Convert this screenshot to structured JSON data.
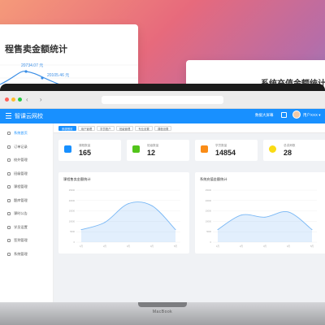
{
  "background": {
    "left_card_title": "课程售卖金额统计",
    "left_card_title_visible": "程售卖金额统计",
    "left_point_label_1": "20734.07 元",
    "left_point_label_2": "20105.46 元",
    "right_card_title": "系统充值金额统计"
  },
  "browser": {
    "dot_colors": [
      "#ff5f57",
      "#febc2e",
      "#28c840"
    ],
    "nav_arrows": "‹ ›"
  },
  "header": {
    "app_title": "智课云网校",
    "big_screen_label": "数据大屏幕",
    "user_name": "用户XXX ▾"
  },
  "sidebar": {
    "items": [
      {
        "label": "系统首页"
      },
      {
        "label": "订单记录"
      },
      {
        "label": "校外管理"
      },
      {
        "label": "班级管理"
      },
      {
        "label": "课程管理"
      },
      {
        "label": "题库管理"
      },
      {
        "label": "课时公告"
      },
      {
        "label": "学员设置"
      },
      {
        "label": "签到管理"
      },
      {
        "label": "系统管理"
      }
    ]
  },
  "tags": [
    {
      "label": "系统首页",
      "active": true
    },
    {
      "label": "用户管理"
    },
    {
      "label": "学员账户"
    },
    {
      "label": "班级管理"
    },
    {
      "label": "专业设置"
    },
    {
      "label": "课程设置"
    }
  ],
  "stats": [
    {
      "label": "课程数量",
      "value": "165",
      "color": "#1890ff",
      "icon": "graduation-cap-icon"
    },
    {
      "label": "班级数量",
      "value": "12",
      "color": "#52c41a",
      "icon": "class-icon"
    },
    {
      "label": "学员数量",
      "value": "14854",
      "color": "#fa8c16",
      "icon": "user-icon"
    },
    {
      "label": "总讲师数",
      "value": "28",
      "color": "#fadb14",
      "icon": "coin-icon"
    }
  ],
  "charts": [
    {
      "title": "课程售卖金额统计"
    },
    {
      "title": "系统充值金额统计"
    }
  ],
  "chart_data": [
    {
      "type": "area",
      "title": "课程售卖金额统计",
      "x": [
        "1月",
        "2月",
        "3月",
        "4月",
        "5月"
      ],
      "y_ticks": [
        "25000",
        "20000",
        "15000",
        "10000",
        "5000",
        "0"
      ],
      "ylim": [
        0,
        25000
      ],
      "values": [
        6000,
        9500,
        18500,
        17500,
        6000
      ],
      "color": "#7ab8f5"
    },
    {
      "type": "area",
      "title": "系统充值金额统计",
      "x": [
        "1月",
        "2月",
        "3月",
        "4月",
        "5月"
      ],
      "y_ticks": [
        "25000",
        "20000",
        "15000",
        "10000",
        "5000",
        "0"
      ],
      "ylim": [
        0,
        25000
      ],
      "values": [
        6000,
        13000,
        12000,
        14500,
        6000
      ],
      "color": "#7ab8f5"
    }
  ],
  "laptop": {
    "brand": "MacBook"
  }
}
